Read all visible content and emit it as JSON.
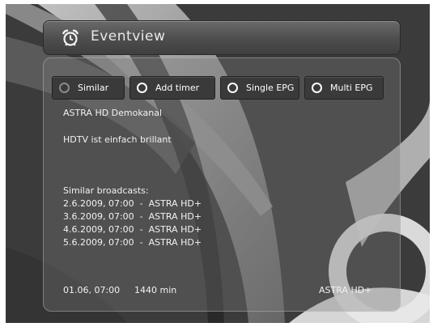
{
  "window": {
    "title": "Eventview",
    "icon": "alarm-clock-icon"
  },
  "buttons": [
    {
      "label": "Similar",
      "icon": "ring-icon"
    },
    {
      "label": "Add timer",
      "icon": "ring-icon"
    },
    {
      "label": "Single EPG",
      "icon": "ring-icon"
    },
    {
      "label": "Multi EPG",
      "icon": "ring-icon"
    }
  ],
  "event": {
    "channel": "ASTRA HD Demokanal",
    "description": "HDTV ist einfach brillant"
  },
  "similar": {
    "heading": "Similar broadcasts:",
    "items": [
      "2.6.2009, 07:00  -  ASTRA HD+",
      "3.6.2009, 07:00  -  ASTRA HD+",
      "4.6.2009, 07:00  -  ASTRA HD+",
      "5.6.2009, 07:00  -  ASTRA HD+"
    ]
  },
  "footer": {
    "datetime": "01.06, 07:00",
    "duration": "1440 min",
    "service": "ASTRA HD+"
  },
  "colors": {
    "background": "#3b3b3b",
    "text": "#f2f2f2",
    "button": "#3a3a3a"
  }
}
